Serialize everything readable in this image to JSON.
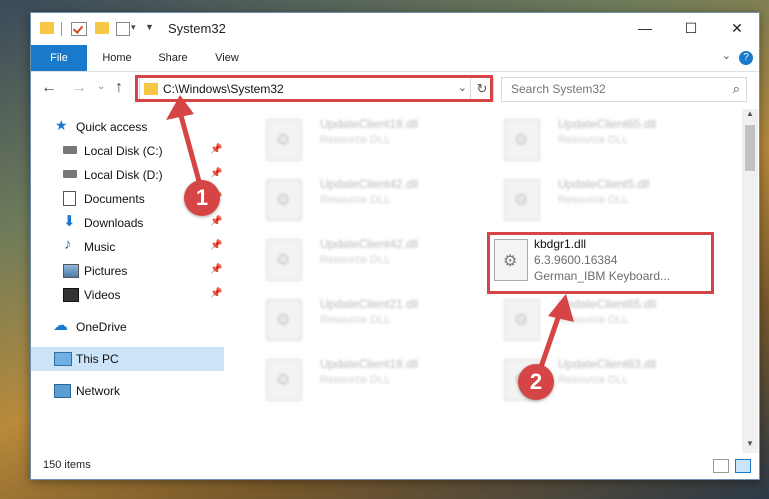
{
  "window": {
    "title": "System32"
  },
  "ribbon": {
    "tabs": [
      "File",
      "Home",
      "Share",
      "View"
    ],
    "help": "?"
  },
  "nav": {
    "address": "C:\\Windows\\System32",
    "search_placeholder": "Search System32"
  },
  "sidebar": {
    "items": [
      {
        "label": "Quick access",
        "icon": "star-icon"
      },
      {
        "label": "Local Disk (C:)",
        "icon": "drive-icon"
      },
      {
        "label": "Local Disk (D:)",
        "icon": "drive-icon"
      },
      {
        "label": "Documents",
        "icon": "documents-icon"
      },
      {
        "label": "Downloads",
        "icon": "download-icon"
      },
      {
        "label": "Music",
        "icon": "music-icon"
      },
      {
        "label": "Pictures",
        "icon": "pictures-icon"
      },
      {
        "label": "Videos",
        "icon": "videos-icon"
      },
      {
        "label": "OneDrive",
        "icon": "cloud-icon"
      },
      {
        "label": "This PC",
        "icon": "computer-icon"
      },
      {
        "label": "Network",
        "icon": "network-icon"
      }
    ]
  },
  "files": [
    {
      "name": "UpdateClient19.dll",
      "desc": "Resource DLL"
    },
    {
      "name": "UpdateClient65.dll",
      "desc": "Resource DLL"
    },
    {
      "name": "UpdateClient42.dll",
      "desc": "Resource DLL"
    },
    {
      "name": "UpdateClient5.dll",
      "desc": "Resource DLL"
    },
    {
      "name": "UpdateClient42.dll",
      "desc": "Resource DLL"
    },
    {
      "name": "UpdateClient21.dll",
      "desc": "Resource DLL"
    },
    {
      "name": "UpdateClient65.dll",
      "desc": "Resource DLL"
    },
    {
      "name": "UpdateClient19.dll",
      "desc": "Resource DLL"
    },
    {
      "name": "UpdateClient63.dll",
      "desc": "Resource DLL"
    }
  ],
  "highlighted_file": {
    "name": "kbdgr1.dll",
    "version": "6.3.9600.16384",
    "desc": "German_IBM Keyboard..."
  },
  "status": {
    "count": "150 items"
  },
  "annotations": {
    "badge1": "1",
    "badge2": "2",
    "color": "#d64545"
  }
}
